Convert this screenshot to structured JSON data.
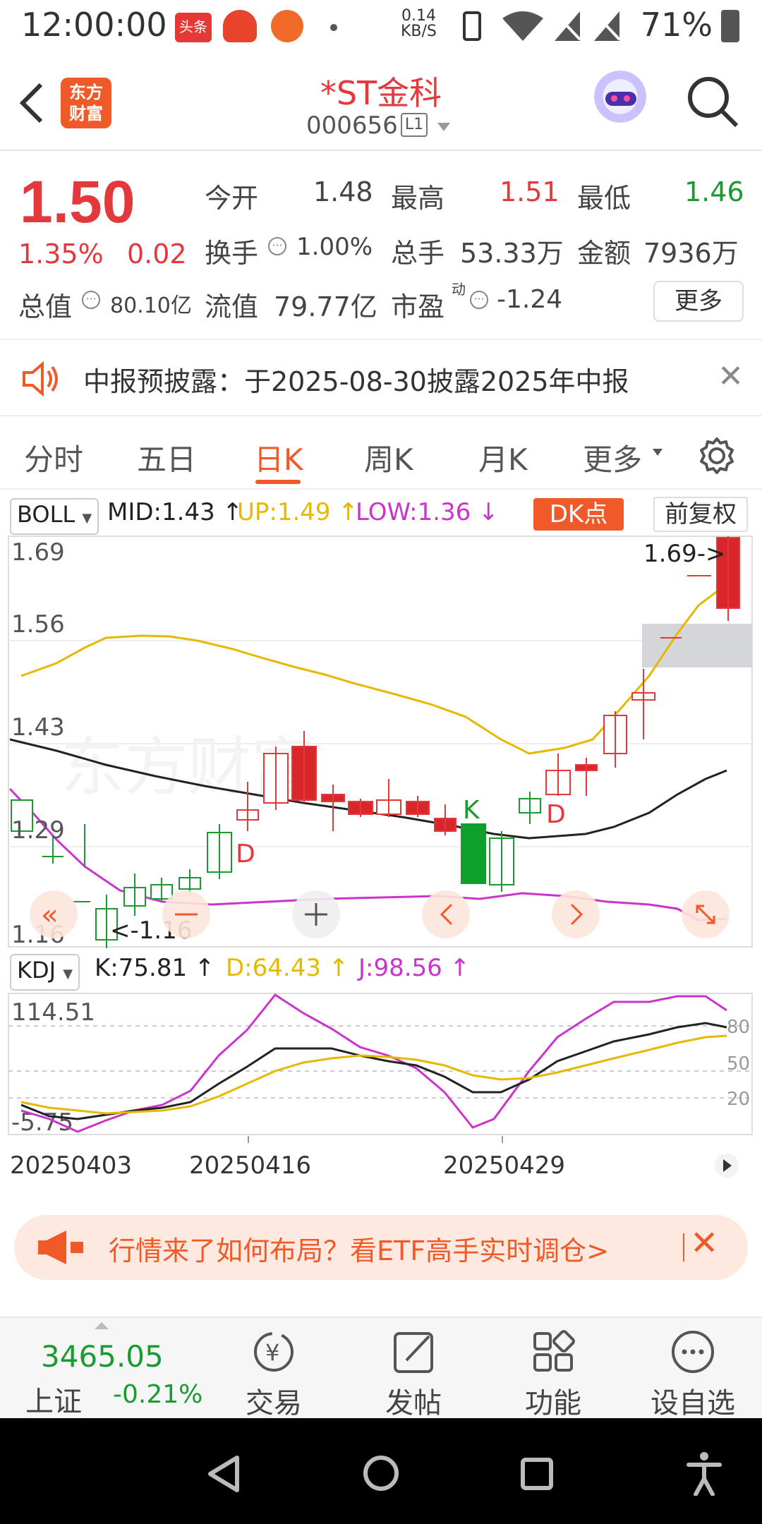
{
  "status": {
    "time": "12:00:00",
    "speed_value": "0.14",
    "speed_unit": "KB/S",
    "battery": "71%",
    "icons": [
      "toutiao-icon",
      "app-icon",
      "app-icon",
      "wifi-icon",
      "battery-icon"
    ]
  },
  "header": {
    "logo": "东方\n财富",
    "title": "*ST金科",
    "code": "000656",
    "level": "L1"
  },
  "quote": {
    "price": "1.50",
    "change_pct": "1.35%",
    "change": "0.02",
    "open_label": "今开",
    "open": "1.48",
    "high_label": "最高",
    "high": "1.51",
    "low_label": "最低",
    "low": "1.46",
    "turnover_label": "换手",
    "turnover": "1.00%",
    "volume_label": "总手",
    "volume": "53.33万",
    "amount_label": "金额",
    "amount": "7936万",
    "mcap_label": "总值",
    "mcap": "80.10亿",
    "float_label": "流值",
    "float_cap": "79.77亿",
    "pe_label": "市盈",
    "pe_sup": "动",
    "pe": "-1.24",
    "more": "更多"
  },
  "notice": {
    "text": "中报预披露：于2025-08-30披露2025年中报"
  },
  "tabs": [
    "分时",
    "五日",
    "日K",
    "周K",
    "月K",
    "更多"
  ],
  "active_tab": "日K",
  "indicator": {
    "boll": "BOLL",
    "mid": "MID:1.43",
    "up": "UP:1.49",
    "low": "LOW:1.36",
    "dk": "DK点",
    "fuquan": "前复权",
    "colors": {
      "mid": "#222222",
      "up": "#e6b800",
      "low": "#cc33cc"
    }
  },
  "kline": {
    "y_labels": [
      "1.69",
      "1.56",
      "1.43",
      "1.29",
      "1.16"
    ],
    "max_tag": "1.69->",
    "min_tag": "<-1.16",
    "markers": [
      "D",
      "K",
      "D"
    ]
  },
  "kdj": {
    "name": "KDJ",
    "k": "K:75.81",
    "d": "D:64.43",
    "j": "J:98.56",
    "y_top": "114.51",
    "y_bottom": "-5.75",
    "right_levels": [
      "80",
      "50",
      "20"
    ]
  },
  "dates": [
    "20250403",
    "20250416",
    "20250429"
  ],
  "ad": {
    "text": "行情来了如何布局？看ETF高手实时调仓>"
  },
  "bottom": {
    "index_value": "3465.05",
    "index_name": "上证",
    "index_change": "-0.21%",
    "items": [
      "交易",
      "发帖",
      "功能",
      "设自选"
    ]
  }
}
